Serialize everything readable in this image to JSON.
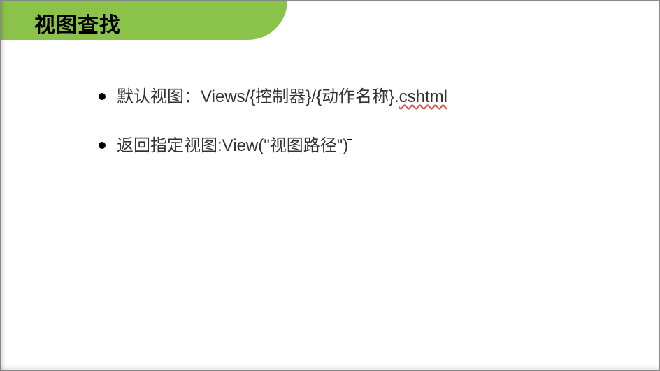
{
  "header": {
    "title": "视图查找",
    "accent_color": "#8bc34a"
  },
  "bullets": [
    {
      "prefix": "默认视图：",
      "body_before": "Views/{控制器}/{动作名称}.",
      "spellchecked": "cshtml",
      "body_after": ""
    },
    {
      "prefix": "返回指定视图:",
      "body_before": "View(\"视图路径\")",
      "spellchecked": "",
      "body_after": ""
    }
  ],
  "cursor_row": 1
}
